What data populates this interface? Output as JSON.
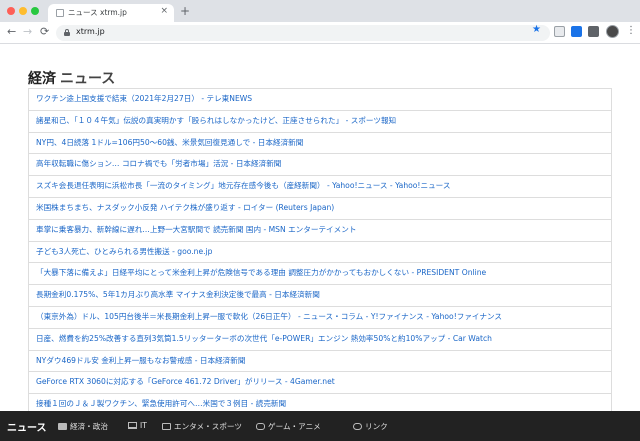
{
  "browser": {
    "tab_title": "ニュース xtrm.jp",
    "tab_close": "×",
    "new_tab": "+",
    "url": "xtrm.jp",
    "back": "←",
    "forward": "→",
    "reload": "⟳",
    "star": "★",
    "menu": "⋮"
  },
  "page": {
    "title": "経済",
    "title_suffix": "ニュース",
    "link_color": "#1a66c7"
  },
  "news": [
    "ワクチン途上国支援で結束（2021年2月27日） - テレ東NEWS",
    "諸星和己、「１０４午気」伝説の真実明かす「殴られはしなかったけど、正座させられた」 - スポーツ報知",
    "NY円、4日続落 1ドル=106円50～60銭、米景気回復見通しで - 日本経済新聞",
    "高年収転職に傷ション… コロナ禍でも「労者市場」活況 - 日本経済新聞",
    "スズキ会長退任表明に浜松市長「一流のタイミング」地元存在感今後も（産経新聞） - Yahoo!ニュース - Yahoo!ニュース",
    "米国株まちまち、ナスダック小反発 ハイテク株が盛り返す - ロイター (Reuters Japan)",
    "車掌に乗客暴力、新幹線に遅れ…上野一大宮駅間で 読売新聞 国内 - MSN エンターテイメント",
    "子ども3人死亡、ひとみられる男性搬送 - goo.ne.jp",
    "「大暴下落に備えよ」日経平均にとって米金利上昇が危険信号である理由 調整圧力がかかってもおかしくない - PRESIDENT Online",
    "長期金利0.175%、5年1カ月ぶり高水準 マイナス金利決定後で最高 - 日本経済新聞",
    "（東京外為）ドル、105円台後半＝米長期金利上昇一服で軟化（26日正午） - ニュース・コラム - Y!ファイナンス - Yahoo!ファイナンス",
    "日産、燃費を約25%改善する直列3気筒1.5リッターターボの次世代「e-POWER」エンジン 熱効率50%と約10%アップ - Car Watch",
    "NYダウ469ドル安 金利上昇一服もなお警戒感 - 日本経済新聞",
    "GeForce RTX 3060に対応する「GeForce 461.72 Driver」がリリース - 4Gamer.net",
    "接種１回のＪ＆Ｊ製ワクチン、緊急使用許可へ…米国で３例目 - 読売新聞"
  ],
  "bottom_nav": {
    "brand": "ニュース",
    "links": [
      {
        "label": "経済・政治",
        "icon": "newspaper-icon"
      },
      {
        "label": "IT",
        "icon": "laptop-icon"
      },
      {
        "label": "エンタメ・スポーツ",
        "icon": "tv-icon"
      },
      {
        "label": "ゲーム・アニメ",
        "icon": "gamepad-icon"
      },
      {
        "label": "リンク",
        "icon": "link-icon"
      }
    ]
  }
}
